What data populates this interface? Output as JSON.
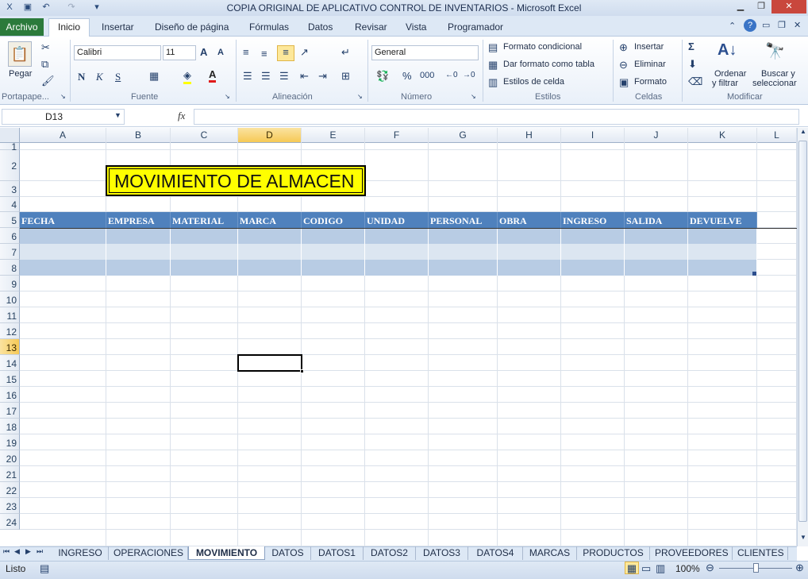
{
  "window": {
    "title": "COPIA ORIGINAL DE APLICATIVO CONTROL DE INVENTARIOS - Microsoft Excel"
  },
  "ribbon": {
    "tabs": [
      "Archivo",
      "Inicio",
      "Insertar",
      "Diseño de página",
      "Fórmulas",
      "Datos",
      "Revisar",
      "Vista",
      "Programador"
    ],
    "active_tab": "Inicio",
    "clipboard": {
      "paste_label": "Pegar",
      "group_label": "Portapape..."
    },
    "font": {
      "family": "Calibri",
      "size": "11",
      "group_label": "Fuente",
      "bold": "N",
      "italic": "K",
      "underline": "S"
    },
    "alignment": {
      "group_label": "Alineación"
    },
    "number": {
      "format": "General",
      "percent": "%",
      "thousands": "000",
      "group_label": "Número"
    },
    "styles": {
      "conditional": "Formato condicional",
      "as_table": "Dar formato como tabla",
      "cell_styles": "Estilos de celda",
      "group_label": "Estilos"
    },
    "cells": {
      "insert": "Insertar",
      "delete": "Eliminar",
      "format": "Formato",
      "group_label": "Celdas"
    },
    "editing": {
      "sort_line1": "Ordenar",
      "sort_line2": "y filtrar",
      "find_line1": "Buscar y",
      "find_line2": "seleccionar",
      "group_label": "Modificar"
    }
  },
  "formula_bar": {
    "name_box": "D13",
    "fx": "fx",
    "formula": ""
  },
  "sheet": {
    "columns": [
      "A",
      "B",
      "C",
      "D",
      "E",
      "F",
      "G",
      "H",
      "I",
      "J",
      "K",
      "L"
    ],
    "selected_column": "D",
    "rows": [
      "1",
      "2",
      "3",
      "4",
      "5",
      "6",
      "7",
      "8",
      "9",
      "10",
      "11",
      "12",
      "13",
      "14",
      "15",
      "16",
      "17",
      "18",
      "19",
      "20",
      "21",
      "22",
      "23",
      "24"
    ],
    "selected_row": "13",
    "title_cell": "MOVIMIENTO DE ALMACEN",
    "table_headers": [
      "FECHA",
      "EMPRESA",
      "MATERIAL",
      "MARCA",
      "CODIGO",
      "UNIDAD",
      "PERSONAL",
      "OBRA",
      "INGRESO",
      "SALIDA",
      "DEVUELVE"
    ],
    "colors": {
      "header_fill": "#4F81BD",
      "band_dark": "#B8CCE4",
      "band_light": "#DCE6F1",
      "title_fill": "#FFFF00"
    }
  },
  "sheet_tabs": [
    "INGRESO",
    "OPERACIONES",
    "MOVIMIENTO",
    "DATOS",
    "DATOS1",
    "DATOS2",
    "DATOS3",
    "DATOS4",
    "MARCAS",
    "PRODUCTOS",
    "PROVEEDORES",
    "CLIENTES"
  ],
  "active_sheet": "MOVIMIENTO",
  "status": {
    "text": "Listo",
    "zoom": "100%"
  }
}
